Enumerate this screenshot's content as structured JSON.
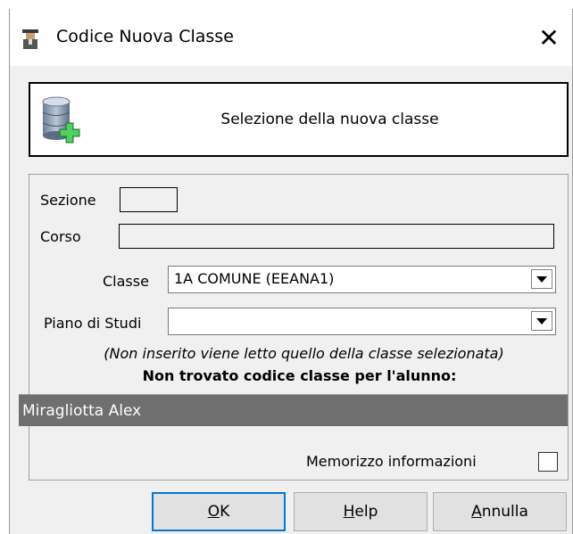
{
  "window": {
    "title": "Codice Nuova Classe",
    "close_glyph": "✕",
    "app_icon": "teacher-figure-icon"
  },
  "header": {
    "icon": "database-add-icon",
    "text": "Selezione della nuova classe"
  },
  "form": {
    "sezione_label": "Sezione",
    "sezione_value": "",
    "corso_label": "Corso",
    "corso_value": "",
    "classe_label": "Classe",
    "classe_value": "1A COMUNE (EEANA1)",
    "piano_label": "Piano di Studi",
    "piano_value": "",
    "note": "(Non inserito viene letto quello della classe selezionata)",
    "warning": "Non trovato codice classe per l'alunno:",
    "student": "Miragliotta Alex",
    "memorizzo_label": "Memorizzo informazioni",
    "memorizzo_checked": false
  },
  "buttons": {
    "ok_accel": "O",
    "ok_rest": "K",
    "help_accel": "H",
    "help_rest": "elp",
    "annulla_accel": "A",
    "annulla_rest": "nnulla"
  },
  "colors": {
    "dialog_bg": "#f0f0f0",
    "student_bar": "#6f6f6f",
    "default_button_border": "#0078d7"
  }
}
